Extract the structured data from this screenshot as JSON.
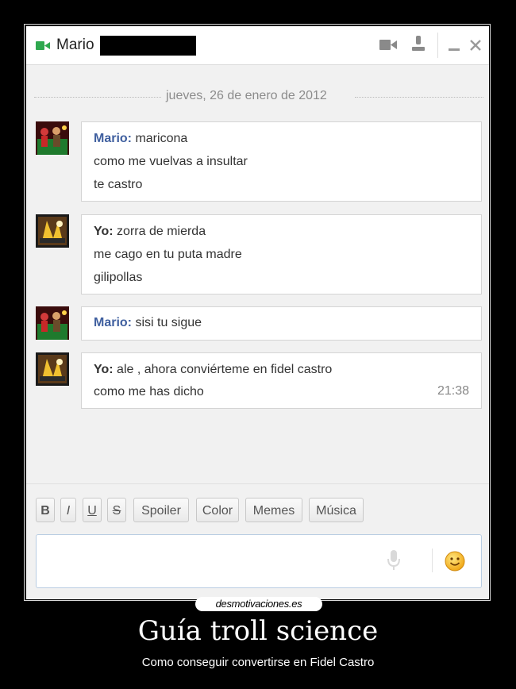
{
  "window": {
    "contact_name": "Mario",
    "icons": {
      "status": "video-camera-icon",
      "video": "video-call-icon",
      "add_person": "add-person-icon",
      "minimize": "minimize-icon",
      "close": "close-icon"
    }
  },
  "chat": {
    "date_separator": "jueves, 26 de enero de 2012",
    "messages": [
      {
        "sender": "Mario:",
        "lines": [
          "maricona",
          "como me vuelvas a insultar",
          "te castro"
        ]
      },
      {
        "sender": "Yo:",
        "lines": [
          "zorra de mierda",
          "me cago en tu puta madre",
          "gilipollas"
        ]
      },
      {
        "sender": "Mario:",
        "lines": [
          "sisi tu sigue"
        ]
      },
      {
        "sender": "Yo:",
        "lines": [
          "ale , ahora conviérteme en fidel castro",
          "como me has dicho"
        ],
        "time": "21:38"
      }
    ]
  },
  "toolbar": {
    "bold": "B",
    "italic": "I",
    "underline": "U",
    "strike": "S",
    "spoiler": "Spoiler",
    "color": "Color",
    "memes": "Memes",
    "music": "Música"
  },
  "input": {
    "value": "",
    "icons": {
      "mic": "microphone-icon",
      "emoji": "smiley-icon"
    }
  },
  "poster": {
    "watermark": "desmotivaciones.es",
    "title": "Guía troll science",
    "subtitle": "Como conseguir convertirse en Fidel Castro"
  },
  "colors": {
    "sender_mario": "#3f5f9f",
    "status_green": "#2fa84f",
    "background": "#000000"
  }
}
